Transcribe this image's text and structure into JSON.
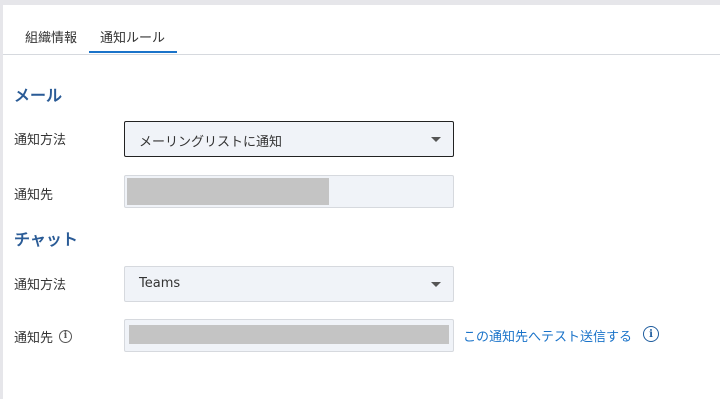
{
  "tabs": [
    {
      "label": "組織情報",
      "active": false
    },
    {
      "label": "通知ルール",
      "active": true
    }
  ],
  "mail": {
    "title": "メール",
    "method_label": "通知方法",
    "method_value": "メーリングリストに通知",
    "dest_label": "通知先"
  },
  "chat": {
    "title": "チャット",
    "method_label": "通知方法",
    "method_value": "Teams",
    "dest_label": "通知先",
    "test_link": "この通知先へテスト送信する"
  },
  "colors": {
    "accent": "#1a73c9",
    "section_title": "#2a5b96",
    "field_bg": "#f0f3f8",
    "redaction": "#c4c4c4"
  },
  "icons": {
    "dest_info": "info-icon",
    "test_info": "info-icon",
    "dropdown": "chevron-down-icon"
  }
}
